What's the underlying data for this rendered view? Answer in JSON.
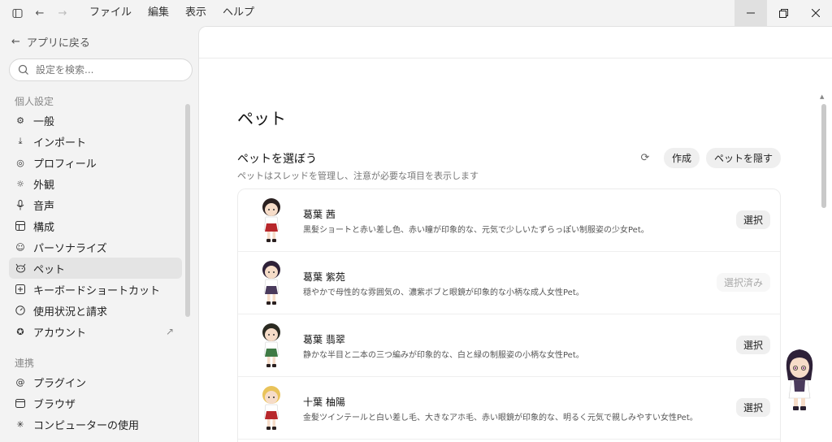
{
  "menu": [
    "ファイル",
    "編集",
    "表示",
    "ヘルプ"
  ],
  "sidebar": {
    "back_label": "アプリに戻る",
    "search_placeholder": "設定を検索...",
    "sections": [
      {
        "label": "個人設定",
        "items": [
          {
            "label": "一般",
            "icon": "gear-icon"
          },
          {
            "label": "インポート",
            "icon": "download-icon"
          },
          {
            "label": "プロフィール",
            "icon": "user-circle-icon"
          },
          {
            "label": "外観",
            "icon": "sun-icon"
          },
          {
            "label": "音声",
            "icon": "microphone-icon"
          },
          {
            "label": "構成",
            "icon": "grid-icon"
          },
          {
            "label": "パーソナライズ",
            "icon": "smile-icon"
          },
          {
            "label": "ペット",
            "icon": "pet-icon",
            "active": true
          },
          {
            "label": "キーボードショートカット",
            "icon": "keyboard-icon"
          },
          {
            "label": "使用状況と請求",
            "icon": "gauge-icon"
          },
          {
            "label": "アカウント",
            "icon": "account-icon",
            "external": true
          }
        ]
      },
      {
        "label": "連携",
        "items": [
          {
            "label": "プラグイン",
            "icon": "at-icon"
          },
          {
            "label": "ブラウザ",
            "icon": "browser-icon"
          },
          {
            "label": "コンピューターの使用",
            "icon": "sparkle-icon"
          }
        ]
      }
    ]
  },
  "main": {
    "title": "ペット",
    "section_title": "ペットを選ぼう",
    "section_subtitle": "ペットはスレッドを管理し、注意が必要な項目を表示します",
    "create_label": "作成",
    "hide_label": "ペットを隠す",
    "pets": [
      {
        "name": "葛葉 茜",
        "desc": "黒髪ショートと赤い差し色、赤い瞳が印象的な、元気で少しいたずらっぽい制服姿の少女Pet。",
        "action": "選択",
        "selected": false,
        "hair": "#2a2020",
        "outfit": "#b8272b"
      },
      {
        "name": "葛葉 紫苑",
        "desc": "穏やかで母性的な雰囲気の、濃紫ボブと眼鏡が印象的な小柄な成人女性Pet。",
        "action": "選択済み",
        "selected": true,
        "hair": "#2e2138",
        "outfit": "#4a3a5c"
      },
      {
        "name": "葛葉 翡翠",
        "desc": "静かな半目と二本の三つ編みが印象的な、白と緑の制服姿の小柄な女性Pet。",
        "action": "選択",
        "selected": false,
        "hair": "#2b2b22",
        "outfit": "#3f7a45"
      },
      {
        "name": "十葉 柚陽",
        "desc": "金髪ツインテールと白い差し毛、大きなアホ毛、赤い眼鏡が印象的な、明るく元気で親しみやすい女性Pet。",
        "action": "選択",
        "selected": false,
        "hair": "#e9c35a",
        "outfit": "#b8272b"
      }
    ]
  }
}
